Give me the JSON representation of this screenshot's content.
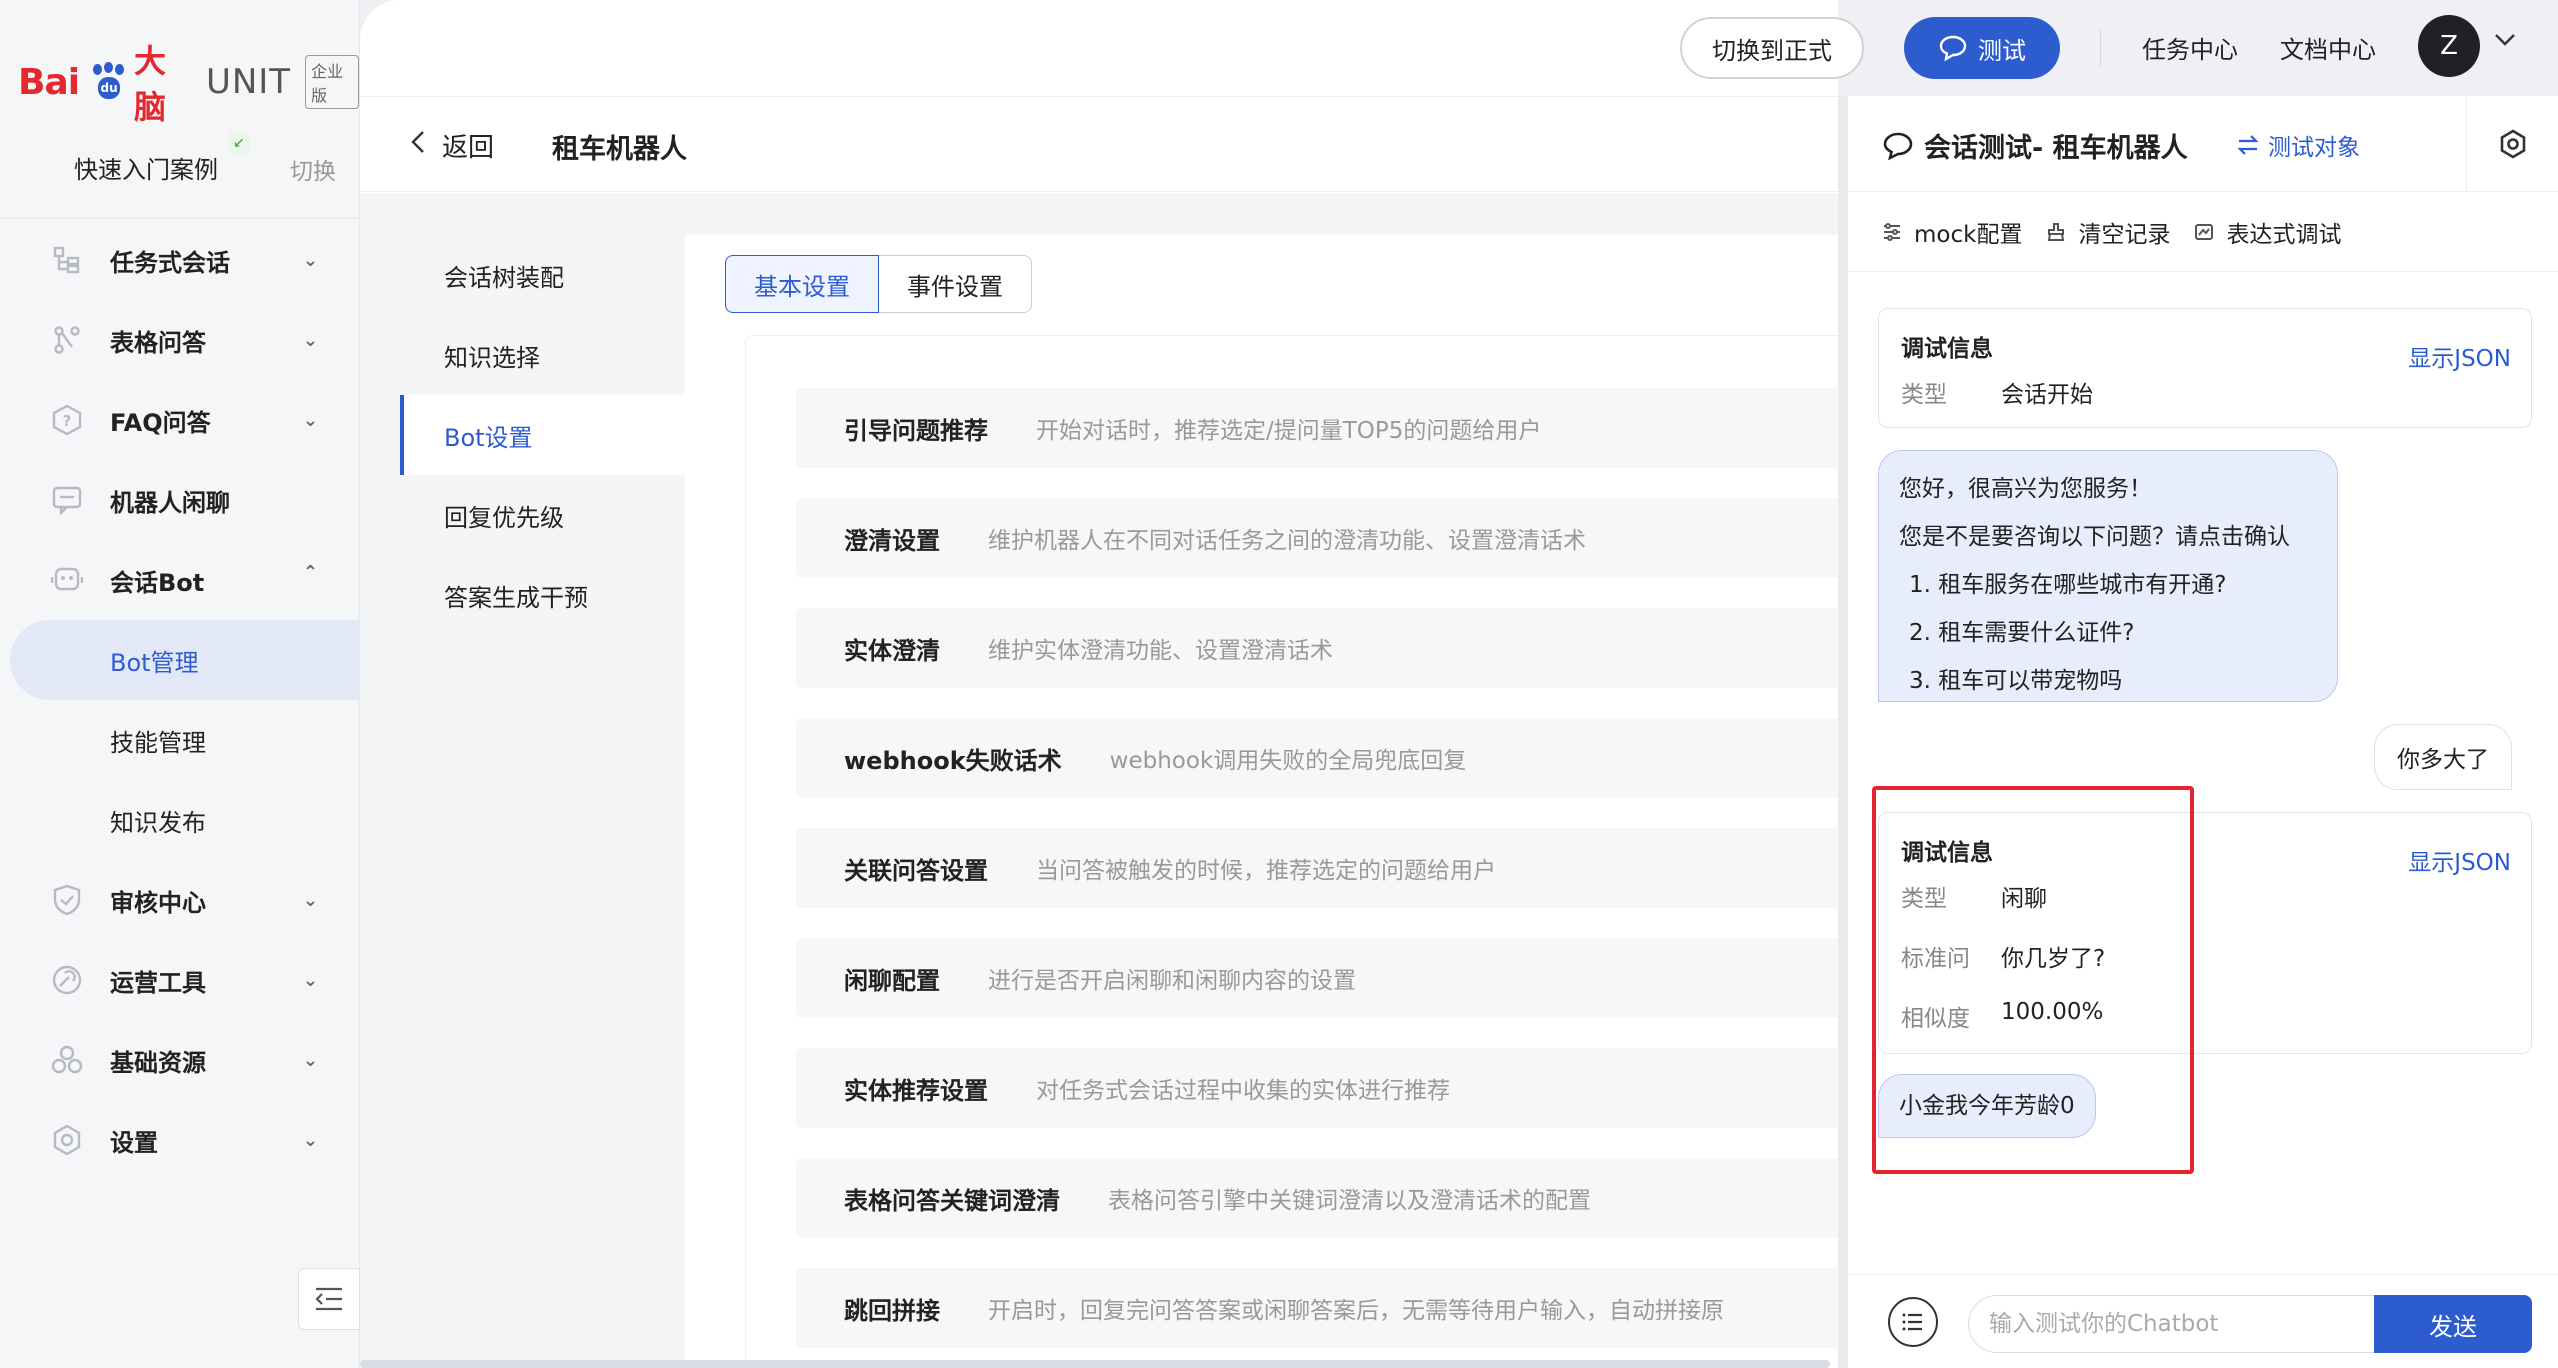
{
  "logo": {
    "bai": "Bai",
    "du": "du",
    "brain": "大脑",
    "unit": "UNIT",
    "edition": "企业版"
  },
  "sidebar": {
    "quick_start": "快速入门案例",
    "quick_badge": "↙",
    "switch": "切换",
    "items": [
      {
        "label": "任务式会话",
        "icon": "task-icon",
        "chev": "⌄"
      },
      {
        "label": "表格问答",
        "icon": "table-qa-icon",
        "chev": "⌄"
      },
      {
        "label": "FAQ问答",
        "icon": "faq-icon",
        "chev": "⌄"
      },
      {
        "label": "机器人闲聊",
        "icon": "chat-icon",
        "chev": ""
      },
      {
        "label": "会话Bot",
        "icon": "bot-icon",
        "chev": "⌃"
      }
    ],
    "sub_items": [
      "Bot管理",
      "技能管理",
      "知识发布"
    ],
    "items_after": [
      {
        "label": "审核中心",
        "icon": "shield-icon",
        "chev": "⌄"
      },
      {
        "label": "运营工具",
        "icon": "tools-icon",
        "chev": "⌄"
      },
      {
        "label": "基础资源",
        "icon": "resource-icon",
        "chev": "⌄"
      },
      {
        "label": "设置",
        "icon": "gear-icon",
        "chev": "⌄"
      }
    ]
  },
  "topbar": {
    "switch_btn": "切换到正式",
    "test_btn": "测试",
    "task_center": "任务中心",
    "doc_center": "文档中心",
    "avatar": "Z"
  },
  "header": {
    "back": "返回",
    "title": "租车机器人"
  },
  "subnav": [
    "会话树装配",
    "知识选择",
    "Bot设置",
    "回复优先级",
    "答案生成干预"
  ],
  "tabs": [
    "基本设置",
    "事件设置"
  ],
  "settings": [
    {
      "name": "引导问题推荐",
      "desc": "开始对话时，推荐选定/提问量TOP5的问题给用户"
    },
    {
      "name": "澄清设置",
      "desc": "维护机器人在不同对话任务之间的澄清功能、设置澄清话术"
    },
    {
      "name": "实体澄清",
      "desc": "维护实体澄清功能、设置澄清话术"
    },
    {
      "name": "webhook失败话术",
      "desc": "webhook调用失败的全局兜底回复"
    },
    {
      "name": "关联问答设置",
      "desc": "当问答被触发的时候，推荐选定的问题给用户"
    },
    {
      "name": "闲聊配置",
      "desc": "进行是否开启闲聊和闲聊内容的设置"
    },
    {
      "name": "实体推荐设置",
      "desc": "对任务式会话过程中收集的实体进行推荐"
    },
    {
      "name": "表格问答关键词澄清",
      "desc": "表格问答引擎中关键词澄清以及澄清话术的配置"
    },
    {
      "name": "跳回拼接",
      "desc": "开启时，回复完问答答案或闲聊答案后，无需等待用户输入，自动拼接原"
    }
  ],
  "chat": {
    "title": "会话测试- 租车机器人",
    "target": "测试对象",
    "tools": [
      "mock配置",
      "清空记录",
      "表达式调试"
    ],
    "debug1": {
      "title": "调试信息",
      "json": "显示JSON",
      "k1": "类型",
      "v1": "会话开始"
    },
    "bot_msg": {
      "l1": "您好，很高兴为您服务！",
      "l2": "您是不是要咨询以下问题？请点击确认",
      "q1": "1. 租车服务在哪些城市有开通?",
      "q2": "2. 租车需要什么证件?",
      "q3": "3. 租车可以带宠物吗"
    },
    "user_msg": "你多大了",
    "debug2": {
      "title": "调试信息",
      "json": "显示JSON",
      "k1": "类型",
      "v1": "闲聊",
      "k2": "标准问",
      "v2": "你几岁了?",
      "k3": "相似度",
      "v3": "100.00%"
    },
    "bot_reply": "小金我今年芳龄0",
    "input_placeholder": "输入测试你的Chatbot",
    "send": "发送"
  }
}
